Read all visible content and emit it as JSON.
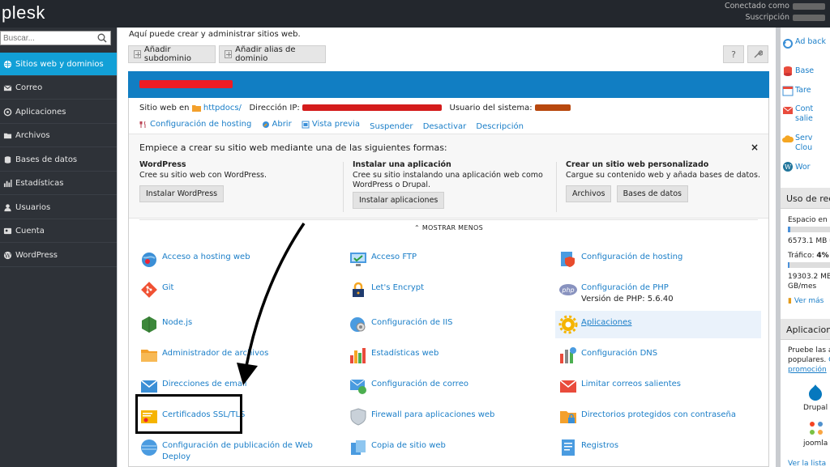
{
  "topbar": {
    "logo": "plesk",
    "connected_label": "Conectado como",
    "subscription_label": "Suscripción"
  },
  "sidebar": {
    "search_placeholder": "Buscar...",
    "items": [
      {
        "label": "Sitios web y dominios",
        "icon": "globe-icon",
        "active": true
      },
      {
        "label": "Correo",
        "icon": "mail-icon"
      },
      {
        "label": "Aplicaciones",
        "icon": "apps-icon"
      },
      {
        "label": "Archivos",
        "icon": "folder-icon"
      },
      {
        "label": "Bases de datos",
        "icon": "database-icon"
      },
      {
        "label": "Estadísticas",
        "icon": "stats-icon"
      },
      {
        "label": "Usuarios",
        "icon": "user-icon"
      },
      {
        "label": "Cuenta",
        "icon": "account-icon"
      },
      {
        "label": "WordPress",
        "icon": "wordpress-icon"
      }
    ]
  },
  "main": {
    "intro": "Aquí puede crear y administrar sitios web.",
    "add_subdomain": "Añadir subdominio",
    "add_alias": "Añadir alias de dominio",
    "help": "?",
    "info": {
      "website_at": "Sitio web en",
      "httpdocs": "httpdocs/",
      "ip_label": "Dirección IP:",
      "system_user_label": "Usuario del sistema:"
    },
    "links": [
      "Configuración de hosting",
      "Abrir",
      "Vista previa",
      "Suspender",
      "Desactivar",
      "Descripción"
    ],
    "start": {
      "title": "Empiece a crear su sitio web mediante una de las siguientes formas:",
      "close": "×",
      "wp": {
        "title": "WordPress",
        "desc": "Cree su sitio web con WordPress.",
        "btn": "Instalar WordPress"
      },
      "app": {
        "title": "Instalar una aplicación",
        "desc": "Cree su sitio instalando una aplicación web como WordPress o Drupal.",
        "btn": "Instalar aplicaciones"
      },
      "custom": {
        "title": "Crear un sitio web personalizado",
        "desc": "Cargue su contenido web y añada bases de datos.",
        "btn1": "Archivos",
        "btn2": "Bases de datos"
      }
    },
    "show_less": "⌃ MOSTRAR MENOS",
    "tools": [
      [
        "Acceso a hosting web",
        "Acceso FTP",
        "Configuración de hosting"
      ],
      [
        "Git",
        "Let's Encrypt",
        "Configuración de PHP"
      ],
      [
        "Node.js",
        "Configuración de IIS",
        "Aplicaciones"
      ],
      [
        "Administrador de archivos",
        "Estadísticas web",
        "Configuración DNS"
      ],
      [
        "Direcciones de email",
        "Configuración de correo",
        "Limitar correos salientes"
      ],
      [
        "Certificados SSL/TLS",
        "Firewall para aplicaciones web",
        "Directorios protegidos con contraseña"
      ],
      [
        "Configuración de publicación de Web Deploy",
        "Copia de sitio web",
        "Registros"
      ]
    ],
    "php_version": "Versión de PHP: 5.6.40"
  },
  "right": {
    "items": [
      "Ad back",
      "Base",
      "Tare",
      "Cont salie",
      "Serv Clou",
      "Wor"
    ],
    "usage_head": "Uso de rec",
    "disk_label": "Espacio en d",
    "disk_value": "6573.1 MB u",
    "traffic_label": "Tráfico:",
    "traffic_pct": "4%",
    "traffic_value": "19303.2 MB",
    "traffic_unit": "GB/mes",
    "more": "Ver más",
    "disk_fill": 0.05,
    "traffic_fill": 0.04,
    "apps_head": "Aplicacion",
    "apps_text1": "Pruebe las a",
    "apps_text2": "populares.",
    "apps_c": "C",
    "apps_promo": "promoción",
    "drupal": "Drupal",
    "joomla": "joomla",
    "see_all": "Ver la lista"
  }
}
